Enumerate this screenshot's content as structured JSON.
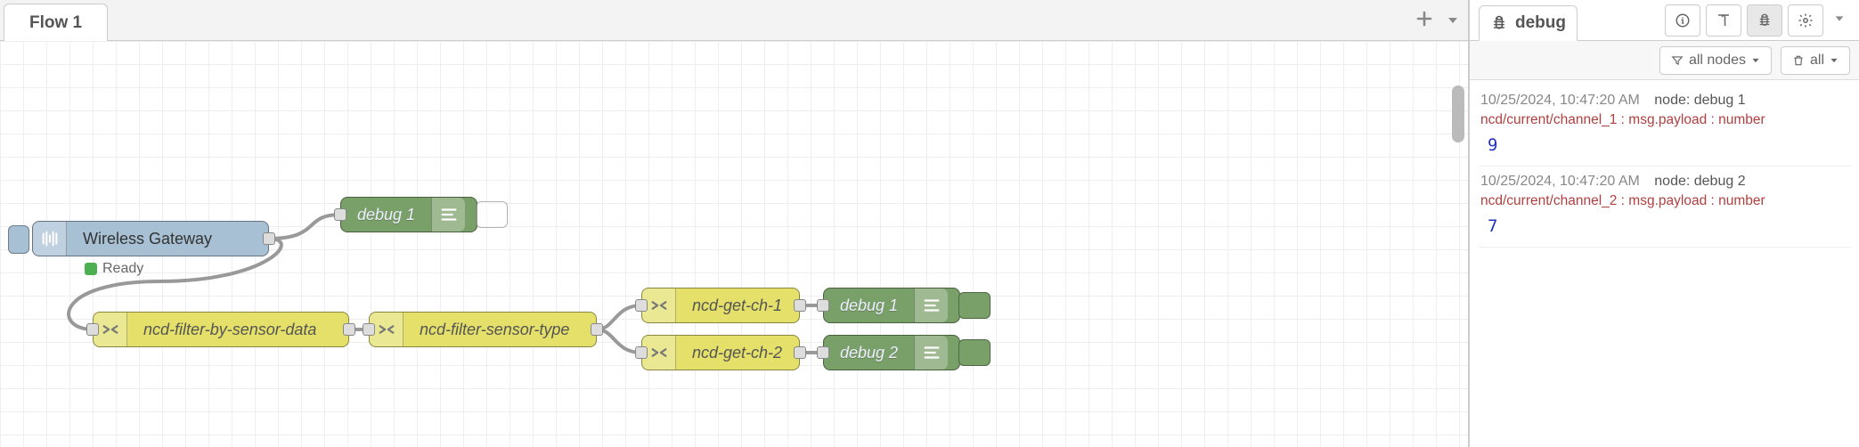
{
  "tabs": {
    "flow1": "Flow 1"
  },
  "nodes": {
    "gateway": {
      "label": "Wireless Gateway",
      "status": "Ready"
    },
    "debug1": {
      "label": "debug 1"
    },
    "filter_sensor_data": {
      "label": "ncd-filter-by-sensor-data"
    },
    "filter_sensor_type": {
      "label": "ncd-filter-sensor-type"
    },
    "get_ch1": {
      "label": "ncd-get-ch-1"
    },
    "get_ch2": {
      "label": "ncd-get-ch-2"
    },
    "debug1b": {
      "label": "debug 1"
    },
    "debug2": {
      "label": "debug 2"
    }
  },
  "sidebar": {
    "title": "debug",
    "filter_label": "all nodes",
    "clear_label": "all"
  },
  "debug_messages": [
    {
      "ts": "10/25/2024, 10:47:20 AM",
      "node": "node: debug 1",
      "topic": "ncd/current/channel_1 : msg.payload : number",
      "value": "9"
    },
    {
      "ts": "10/25/2024, 10:47:20 AM",
      "node": "node: debug 2",
      "topic": "ncd/current/channel_2 : msg.payload : number",
      "value": "7"
    }
  ]
}
